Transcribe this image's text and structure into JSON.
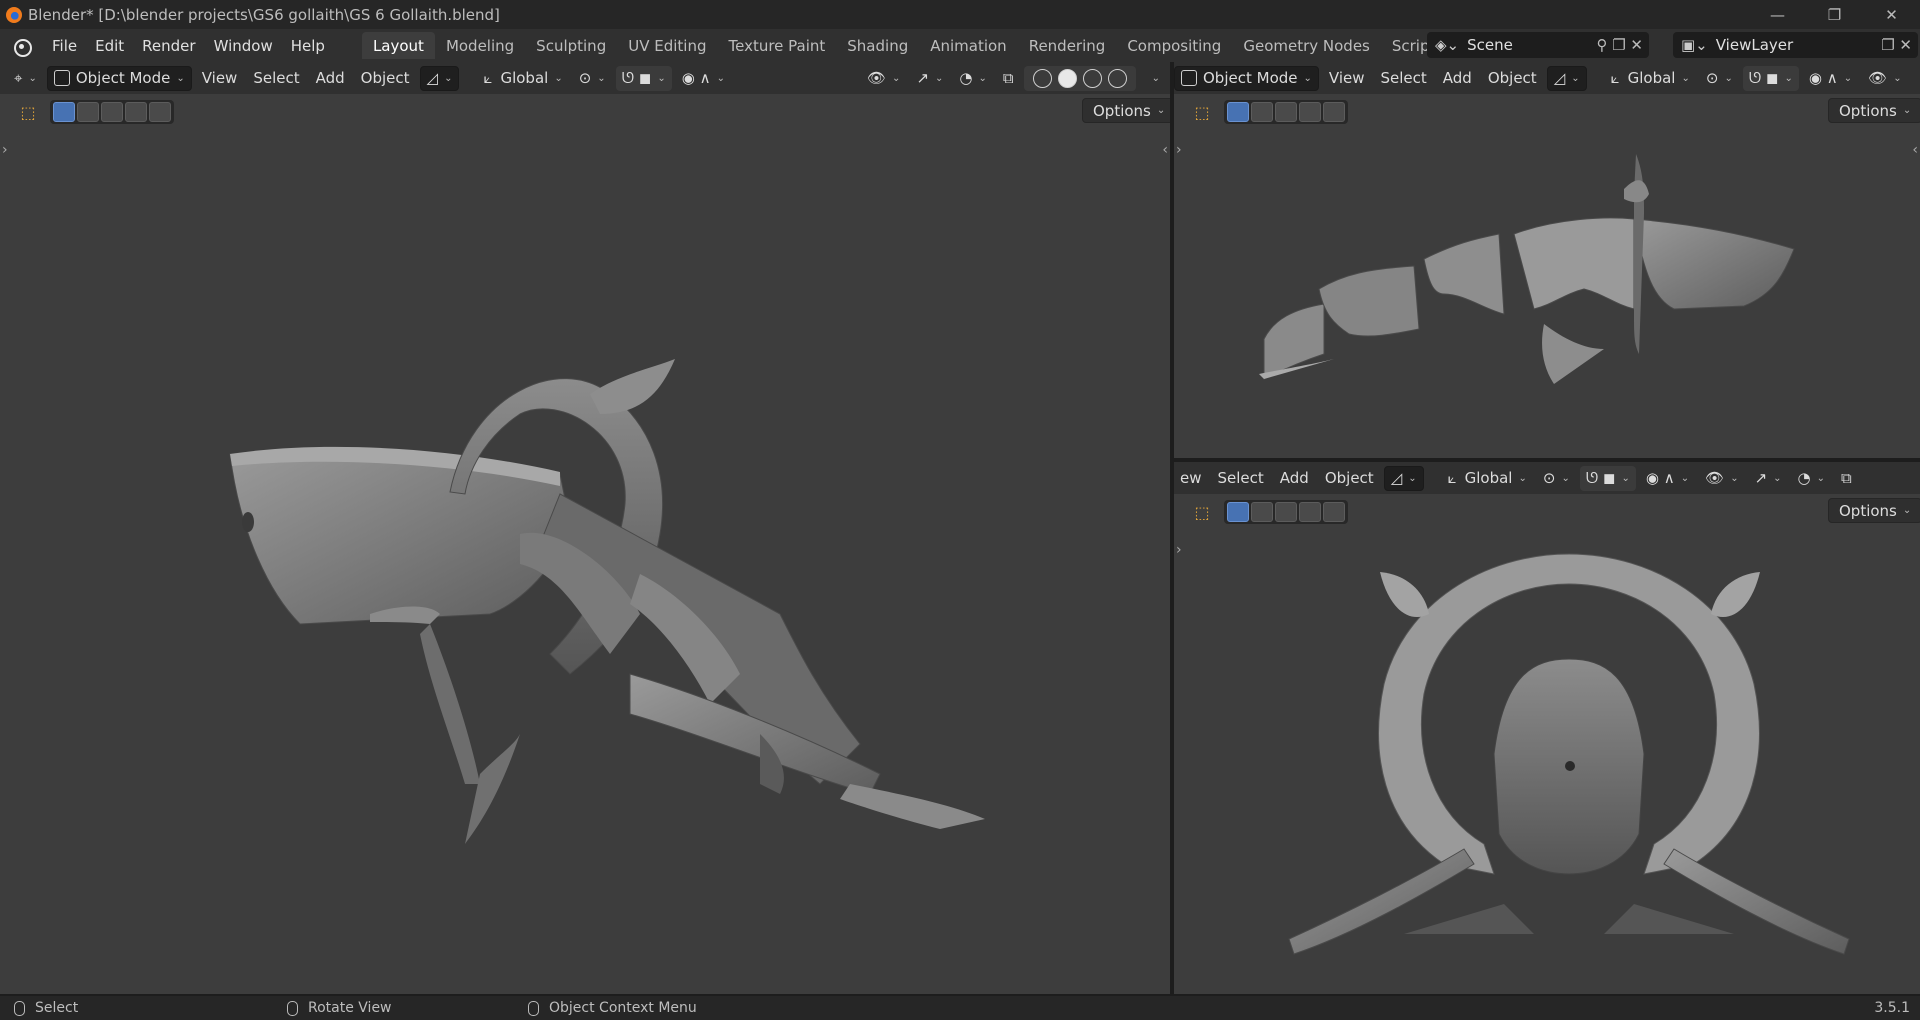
{
  "window": {
    "title": "Blender* [D:\\blender projects\\GS6 gollaith\\GS 6 Gollaith.blend]",
    "minimize": "—",
    "maximize": "❐",
    "close": "✕"
  },
  "menu": [
    "File",
    "Edit",
    "Render",
    "Window",
    "Help"
  ],
  "workspaces": [
    "Layout",
    "Modeling",
    "Sculpting",
    "UV Editing",
    "Texture Paint",
    "Shading",
    "Animation",
    "Rendering",
    "Compositing",
    "Geometry Nodes",
    "Scripting"
  ],
  "active_workspace": "Layout",
  "add_workspace": "+",
  "scene": {
    "name": "Scene"
  },
  "view_layer": {
    "name": "ViewLayer"
  },
  "viewport_left": {
    "mode": "Object Mode",
    "menus": [
      "View",
      "Select",
      "Add",
      "Object"
    ],
    "orientation": "Global",
    "options": "Options"
  },
  "viewport_top_right": {
    "mode": "Object Mode",
    "menus": [
      "View",
      "Select",
      "Add",
      "Object"
    ],
    "orientation": "Global",
    "options": "Options"
  },
  "viewport_bottom_right": {
    "cut_label": "ew",
    "menus": [
      "Select",
      "Add",
      "Object"
    ],
    "orientation": "Global",
    "options": "Options"
  },
  "status": {
    "select": "Select",
    "rotate": "Rotate View",
    "context": "Object Context Menu",
    "version": "3.5.1"
  },
  "colors": {
    "header": "#303030",
    "viewport": "#3d3d3d",
    "accent": "#4772b3",
    "tool": "#e8a93a"
  }
}
